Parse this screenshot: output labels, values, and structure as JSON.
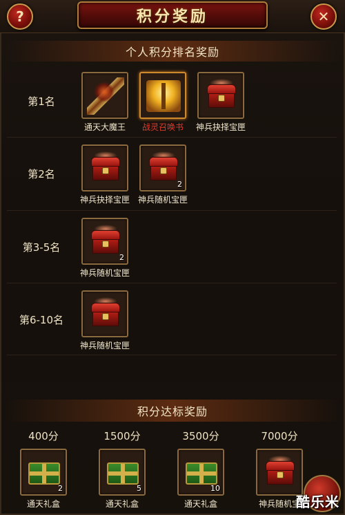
{
  "header": {
    "title": "积分奖励",
    "help_label": "?",
    "close_label": "✕"
  },
  "personal": {
    "title": "个人积分排名奖励",
    "ranks": [
      {
        "label": "第1名",
        "items": [
          {
            "name": "通天大魔王",
            "icon": "weapon-icon",
            "count": "",
            "highlight": false
          },
          {
            "name": "战灵召唤书",
            "icon": "book-icon",
            "count": "",
            "highlight": true
          },
          {
            "name": "神兵抉择宝匣",
            "icon": "chest-icon",
            "count": "",
            "highlight": false
          }
        ]
      },
      {
        "label": "第2名",
        "items": [
          {
            "name": "神兵抉择宝匣",
            "icon": "chest-icon",
            "count": ""
          },
          {
            "name": "神兵随机宝匣",
            "icon": "chest-icon",
            "count": "2"
          }
        ]
      },
      {
        "label": "第3-5名",
        "items": [
          {
            "name": "神兵随机宝匣",
            "icon": "chest-icon",
            "count": "2"
          }
        ]
      },
      {
        "label": "第6-10名",
        "items": [
          {
            "name": "神兵随机宝匣",
            "icon": "chest-icon",
            "count": ""
          }
        ]
      }
    ]
  },
  "milestones": {
    "title": "积分达标奖励",
    "items": [
      {
        "points": "400分",
        "name": "通天礼盒",
        "icon": "green-giftbox-icon",
        "count": "2"
      },
      {
        "points": "1500分",
        "name": "通天礼盒",
        "icon": "green-giftbox-icon",
        "count": "5"
      },
      {
        "points": "3500分",
        "name": "通天礼盒",
        "icon": "green-giftbox-icon",
        "count": "10"
      },
      {
        "points": "7000分",
        "name": "神兵随机宝",
        "icon": "chest-icon",
        "count": ""
      }
    ]
  },
  "watermark": "酷乐米",
  "colors": {
    "accent_red": "#7a1410",
    "gold_border": "#b07c3a",
    "highlight_name": "#e23a2a"
  }
}
